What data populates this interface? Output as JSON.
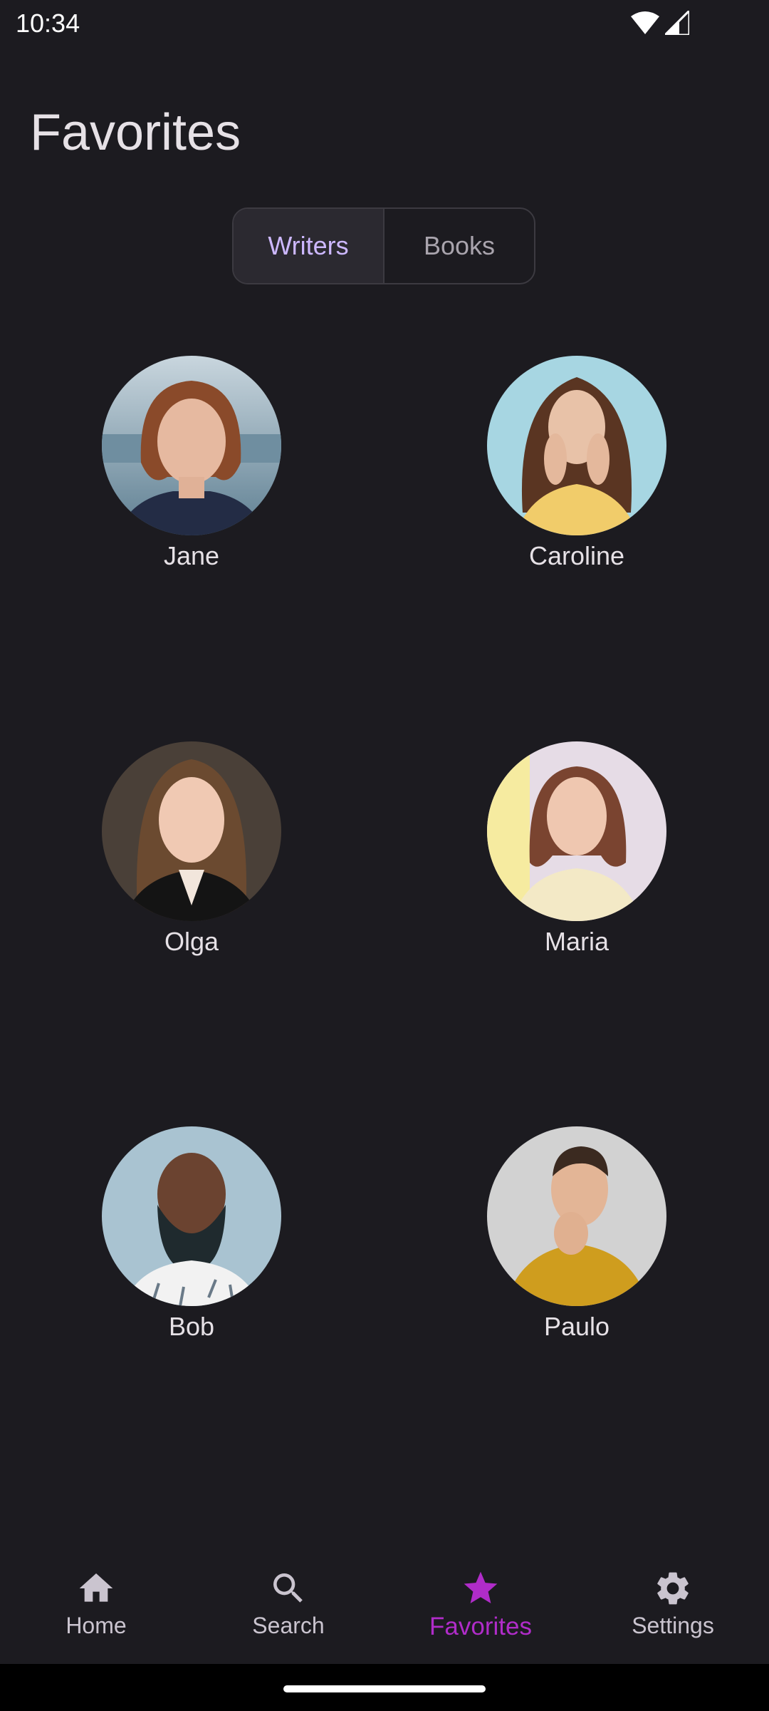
{
  "status_bar": {
    "time": "10:34"
  },
  "header": {
    "title": "Favorites"
  },
  "tabs": [
    {
      "label": "Writers",
      "selected": true
    },
    {
      "label": "Books",
      "selected": false
    }
  ],
  "writers": [
    {
      "name": "Jane"
    },
    {
      "name": "Caroline"
    },
    {
      "name": "Olga"
    },
    {
      "name": "Maria"
    },
    {
      "name": "Bob"
    },
    {
      "name": "Paulo"
    }
  ],
  "bottom_nav": {
    "items": [
      {
        "label": "Home",
        "icon": "home-icon"
      },
      {
        "label": "Search",
        "icon": "search-icon"
      },
      {
        "label": "Favorites",
        "icon": "star-icon",
        "active": true
      },
      {
        "label": "Settings",
        "icon": "gear-icon"
      }
    ]
  },
  "colors": {
    "background": "#1c1b20",
    "accent": "#b02cc9",
    "selected_tab_text": "#cdb8ff"
  }
}
